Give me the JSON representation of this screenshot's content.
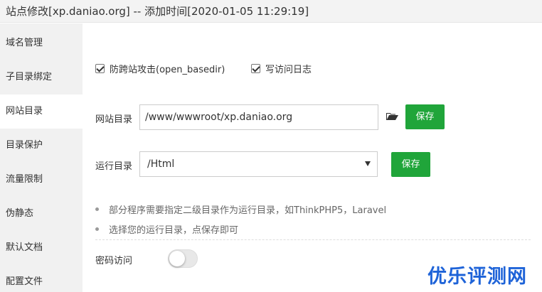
{
  "window": {
    "title": "站点修改[xp.daniao.org] -- 添加时间[2020-01-05 11:29:19]"
  },
  "sidebar": {
    "items": [
      {
        "label": "域名管理"
      },
      {
        "label": "子目录绑定"
      },
      {
        "label": "网站目录",
        "active": true
      },
      {
        "label": "目录保护"
      },
      {
        "label": "流量限制"
      },
      {
        "label": "伪静态"
      },
      {
        "label": "默认文档"
      },
      {
        "label": "配置文件"
      }
    ]
  },
  "main": {
    "options": {
      "open_basedir": {
        "label": "防跨站攻击(open_basedir)",
        "checked": true
      },
      "access_log": {
        "label": "写访问日志",
        "checked": true
      }
    },
    "site_dir": {
      "label": "网站目录",
      "value": "/www/wwwroot/xp.daniao.org",
      "folder_icon": "folder-open-icon",
      "save_label": "保存"
    },
    "run_dir": {
      "label": "运行目录",
      "value": "/Html",
      "save_label": "保存"
    },
    "tips": [
      "部分程序需要指定二级目录作为运行目录，如ThinkPHP5，Laravel",
      "选择您的运行目录，点保存即可"
    ],
    "password_access": {
      "label": "密码访问",
      "enabled": false
    }
  },
  "watermark": "优乐评测网",
  "colors": {
    "accent": "#20a53a",
    "sidebar_bg": "#f1f1f1",
    "watermark": "#1e63d8"
  }
}
